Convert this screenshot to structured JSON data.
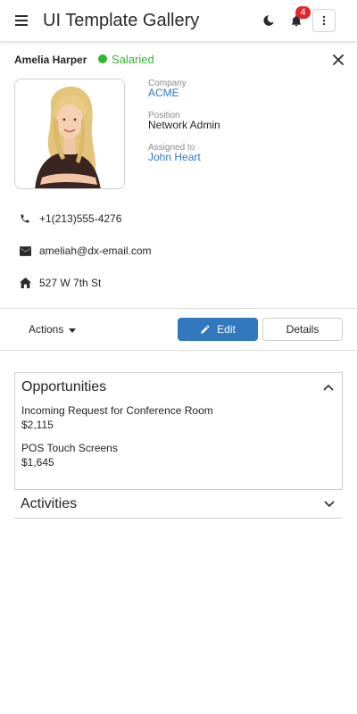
{
  "header": {
    "title": "UI Template Gallery",
    "notification_count": "4",
    "icons": {
      "menu": "hamburger-icon",
      "theme": "moon-icon",
      "notifications": "bell-icon",
      "more": "vertical-ellipsis-icon"
    }
  },
  "contact": {
    "name": "Amelia Harper",
    "status": "Salaried",
    "status_color": "#2eb82e",
    "photo": "woman-portrait-photo",
    "company_label": "Company",
    "company": "ACME",
    "position_label": "Position",
    "position": "Network Admin",
    "assigned_label": "Assigned to",
    "assigned": "John Heart",
    "phone": "+1(213)555-4276",
    "email": "ameliah@dx-email.com",
    "address": "527 W 7th St"
  },
  "toolbar": {
    "actions_label": "Actions",
    "edit_label": "Edit",
    "details_label": "Details"
  },
  "opportunities": {
    "title": "Opportunities",
    "items": [
      {
        "name": "Incoming Request for Conference Room",
        "amount": "$2,115"
      },
      {
        "name": "POS Touch Screens",
        "amount": "$1,645"
      }
    ]
  },
  "activities": {
    "title": "Activities"
  },
  "colors": {
    "accent": "#3278be",
    "link": "#2a7ac6",
    "badge": "#e0242c"
  }
}
